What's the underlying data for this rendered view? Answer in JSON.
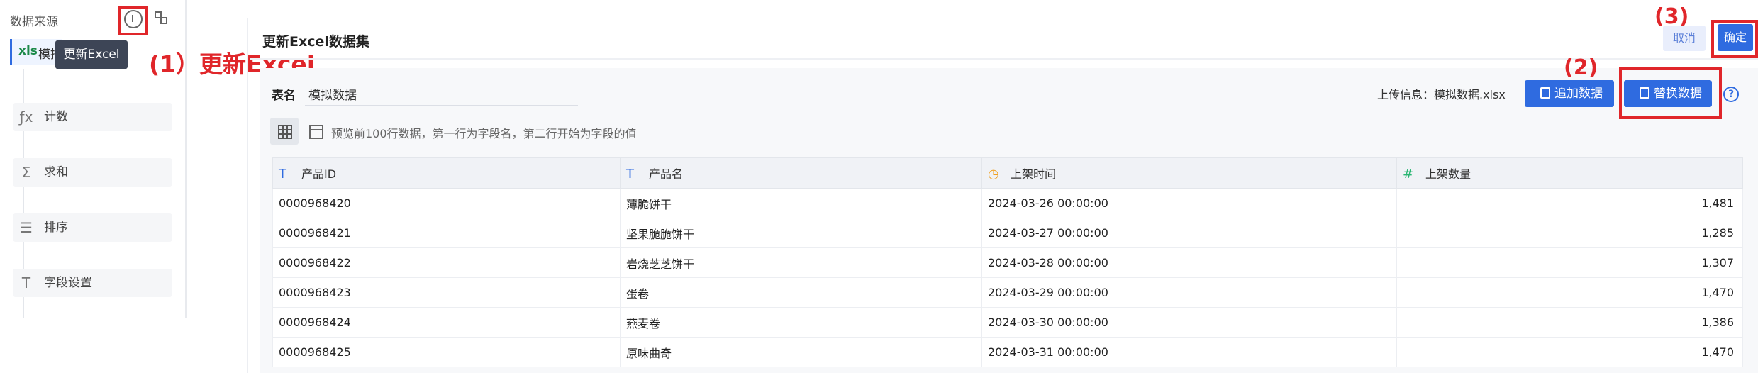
{
  "sidebar": {
    "title": "数据来源",
    "active_item": {
      "badge": "xls",
      "label": "模拟数据"
    },
    "tooltip": "更新Excel",
    "items": [
      {
        "icon": "fx-icon",
        "glyph": "ƒx",
        "label": "计数"
      },
      {
        "icon": "sigma-icon",
        "glyph": "Σ",
        "label": "求和"
      },
      {
        "icon": "sort-icon",
        "glyph": "☰",
        "label": "排序"
      },
      {
        "icon": "field-settings-icon",
        "glyph": "T",
        "label": "字段设置"
      }
    ]
  },
  "annotations": {
    "step1": "(1）更新Excel",
    "step2": "(2)",
    "step3": "(3)"
  },
  "header": {
    "title": "更新Excel数据集",
    "cancel": "取消",
    "confirm": "确定"
  },
  "form": {
    "table_label": "表名",
    "table_value": "模拟数据",
    "upload_info": "上传信息：模拟数据.xlsx",
    "append_button": "追加数据",
    "replace_button": "替换数据",
    "help": "?",
    "preview_note": "预览前100行数据，第一行为字段名，第二行开始为字段的值"
  },
  "table": {
    "columns": [
      {
        "name": "产品ID",
        "type_glyph": "T",
        "color": "#2f6be0"
      },
      {
        "name": "产品名",
        "type_glyph": "T",
        "color": "#2f6be0"
      },
      {
        "name": "上架时间",
        "type_glyph": "◷",
        "color": "#f0a020"
      },
      {
        "name": "上架数量",
        "type_glyph": "#",
        "color": "#2bb673"
      }
    ],
    "rows": [
      [
        "0000968420",
        "薄脆饼干",
        "2024-03-26 00:00:00",
        "1,481"
      ],
      [
        "0000968421",
        "坚果脆脆饼干",
        "2024-03-27 00:00:00",
        "1,285"
      ],
      [
        "0000968422",
        "岩烧芝芝饼干",
        "2024-03-28 00:00:00",
        "1,307"
      ],
      [
        "0000968423",
        "蛋卷",
        "2024-03-29 00:00:00",
        "1,470"
      ],
      [
        "0000968424",
        "燕麦卷",
        "2024-03-30 00:00:00",
        "1,386"
      ],
      [
        "0000968425",
        "原味曲奇",
        "2024-03-31 00:00:00",
        "1,470"
      ]
    ]
  },
  "colors": {
    "primary": "#2f6be0",
    "highlight": "#e0262a"
  }
}
